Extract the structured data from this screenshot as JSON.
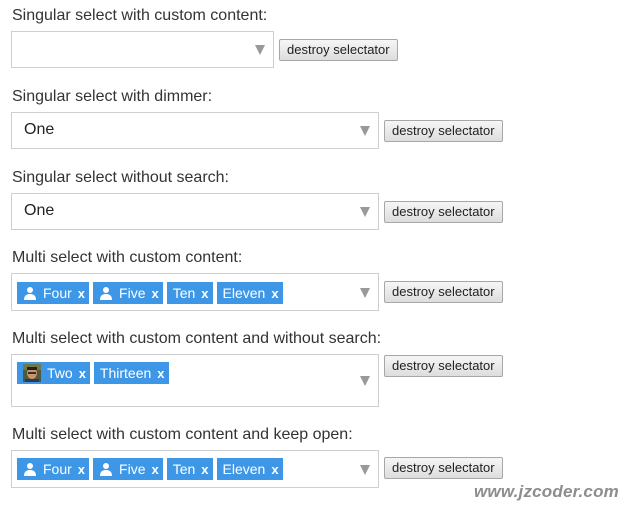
{
  "sections": [
    {
      "label": "Singular select with custom content:",
      "value": "",
      "button": "destroy selectator"
    },
    {
      "label": "Singular select with dimmer:",
      "value": "One",
      "button": "destroy selectator"
    },
    {
      "label": "Singular select without search:",
      "value": "One",
      "button": "destroy selectator"
    },
    {
      "label": "Multi select with custom content:",
      "button": "destroy selectator",
      "tags": [
        {
          "text": "Four",
          "icon": "user-icon",
          "remove": "x"
        },
        {
          "text": "Five",
          "icon": "user-icon",
          "remove": "x"
        },
        {
          "text": "Ten",
          "remove": "x"
        },
        {
          "text": "Eleven",
          "remove": "x"
        }
      ]
    },
    {
      "label": "Multi select with custom content and without search:",
      "button": "destroy selectator",
      "tags": [
        {
          "text": "Two",
          "icon": "avatar-photo",
          "remove": "x"
        },
        {
          "text": "Thirteen",
          "remove": "x"
        }
      ]
    },
    {
      "label": "Multi select with custom content and keep open:",
      "button": "destroy selectator",
      "tags": [
        {
          "text": "Four",
          "icon": "user-icon",
          "remove": "x"
        },
        {
          "text": "Five",
          "icon": "user-icon",
          "remove": "x"
        },
        {
          "text": "Ten",
          "remove": "x"
        },
        {
          "text": "Eleven",
          "remove": "x"
        }
      ]
    }
  ],
  "watermark": "www.jzcoder.com",
  "colors": {
    "tag": "#3d97e6",
    "border": "#cfcfcf",
    "arrow": "#999999"
  }
}
